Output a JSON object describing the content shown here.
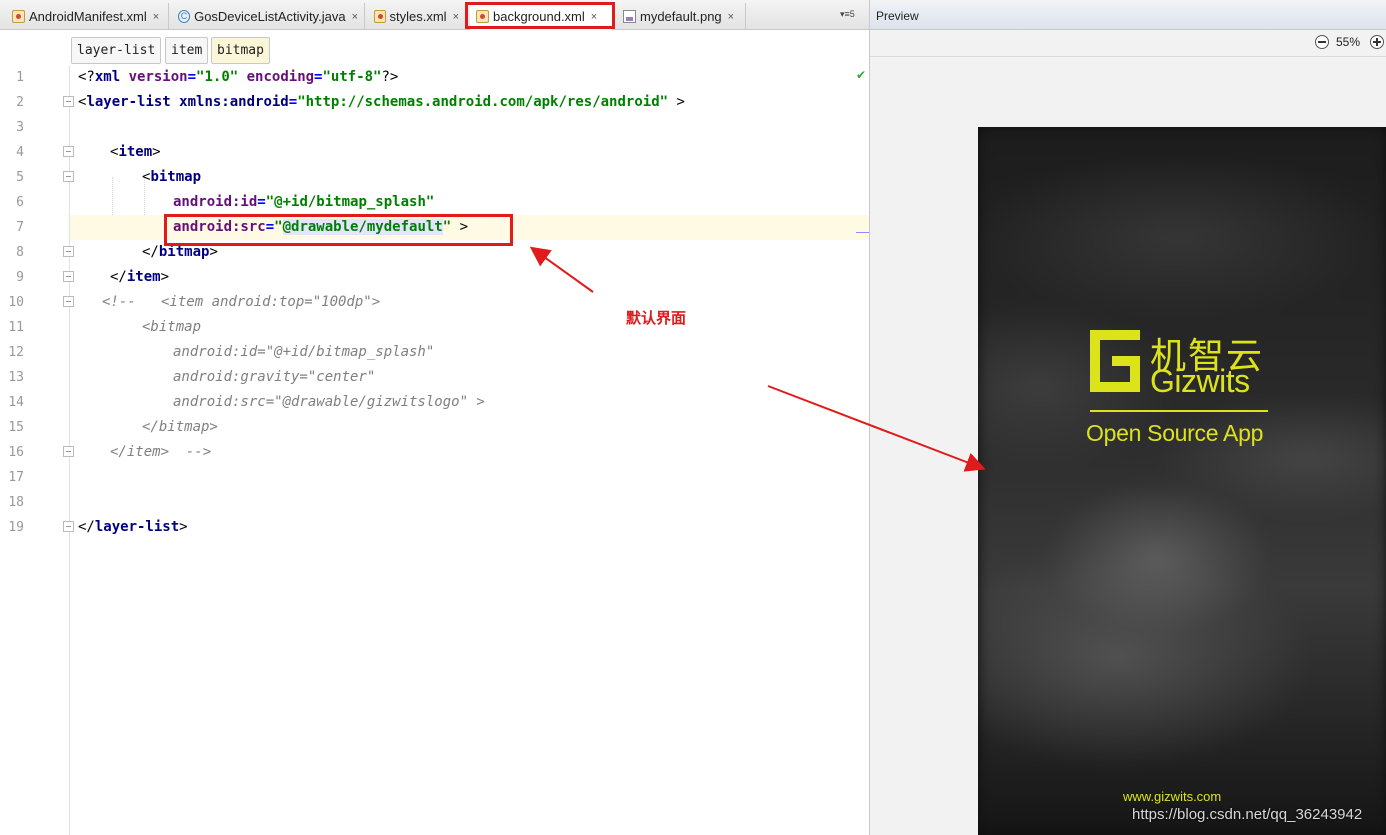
{
  "tabs": [
    {
      "label": "AndroidManifest.xml",
      "icon": "xml-file-icon",
      "active": false
    },
    {
      "label": "GosDeviceListActivity.java",
      "icon": "java-class-icon",
      "active": false
    },
    {
      "label": "styles.xml",
      "icon": "xml-file-icon",
      "active": false
    },
    {
      "label": "background.xml",
      "icon": "xml-file-icon",
      "active": true
    },
    {
      "label": "mydefault.png",
      "icon": "png-file-icon",
      "active": false
    }
  ],
  "tab_close_glyph": "×",
  "tab_overflow": "▾≡5",
  "breadcrumb": [
    "layer-list",
    "item",
    "bitmap"
  ],
  "line_numbers": [
    "1",
    "2",
    "3",
    "4",
    "5",
    "6",
    "7",
    "8",
    "9",
    "10",
    "11",
    "12",
    "13",
    "14",
    "15",
    "16",
    "17",
    "18",
    "19"
  ],
  "code": {
    "l1_open": "<?",
    "l1_tag": "xml",
    "l1_a1": " version",
    "l1_e1": "=",
    "l1_v1": "\"1.0\"",
    "l1_a2": " encoding",
    "l1_e2": "=",
    "l1_v2": "\"utf-8\"",
    "l1_close": "?>",
    "l2_open": "<",
    "l2_tag": "layer-list",
    "l2_a": " xmlns:android",
    "l2_e": "=",
    "l2_v": "\"http://schemas.android.com/apk/res/android\"",
    "l2_close": " >",
    "l4_open": "<",
    "l4_tag": "item",
    "l4_close": ">",
    "l5_open": "<",
    "l5_tag": "bitmap",
    "l6_a": "android:id",
    "l6_e": "=",
    "l6_v": "\"@+id/bitmap_splash\"",
    "l7_a": "android:src",
    "l7_e": "=",
    "l7_q1": "\"",
    "l7_ref": "@drawable/mydefault",
    "l7_q2": "\"",
    "l7_close": " >",
    "l8": "</",
    "l8_tag": "bitmap",
    "l8_close": ">",
    "l9": "</",
    "l9_tag": "item",
    "l9_close": ">",
    "l10": "<!--   <item android:top=\"100dp\">",
    "l11": "<bitmap",
    "l12": "android:id=\"@+id/bitmap_splash\"",
    "l13": "android:gravity=\"center\"",
    "l14": "android:src=\"@drawable/gizwitslogo\" >",
    "l15": "</bitmap>",
    "l16": "</item>  -->",
    "l19_open": "</",
    "l19_tag": "layer-list",
    "l19_close": ">"
  },
  "annotation": "默认界面",
  "preview": {
    "title": "Preview",
    "zoom": "55%",
    "logo_cn": "机智云",
    "logo_en": "Gizwits",
    "tagline": "Open Source App",
    "site": "www.gizwits.com"
  },
  "watermark": "https://blog.csdn.net/qq_36243942",
  "colors": {
    "highlight_red": "#e01b1b",
    "brand_yellow": "#dde31b",
    "xml_tag": "#000080",
    "xml_attr": "#660e7a",
    "xml_string": "#008000",
    "comment": "#808080",
    "caret_row": "#fffae3"
  }
}
